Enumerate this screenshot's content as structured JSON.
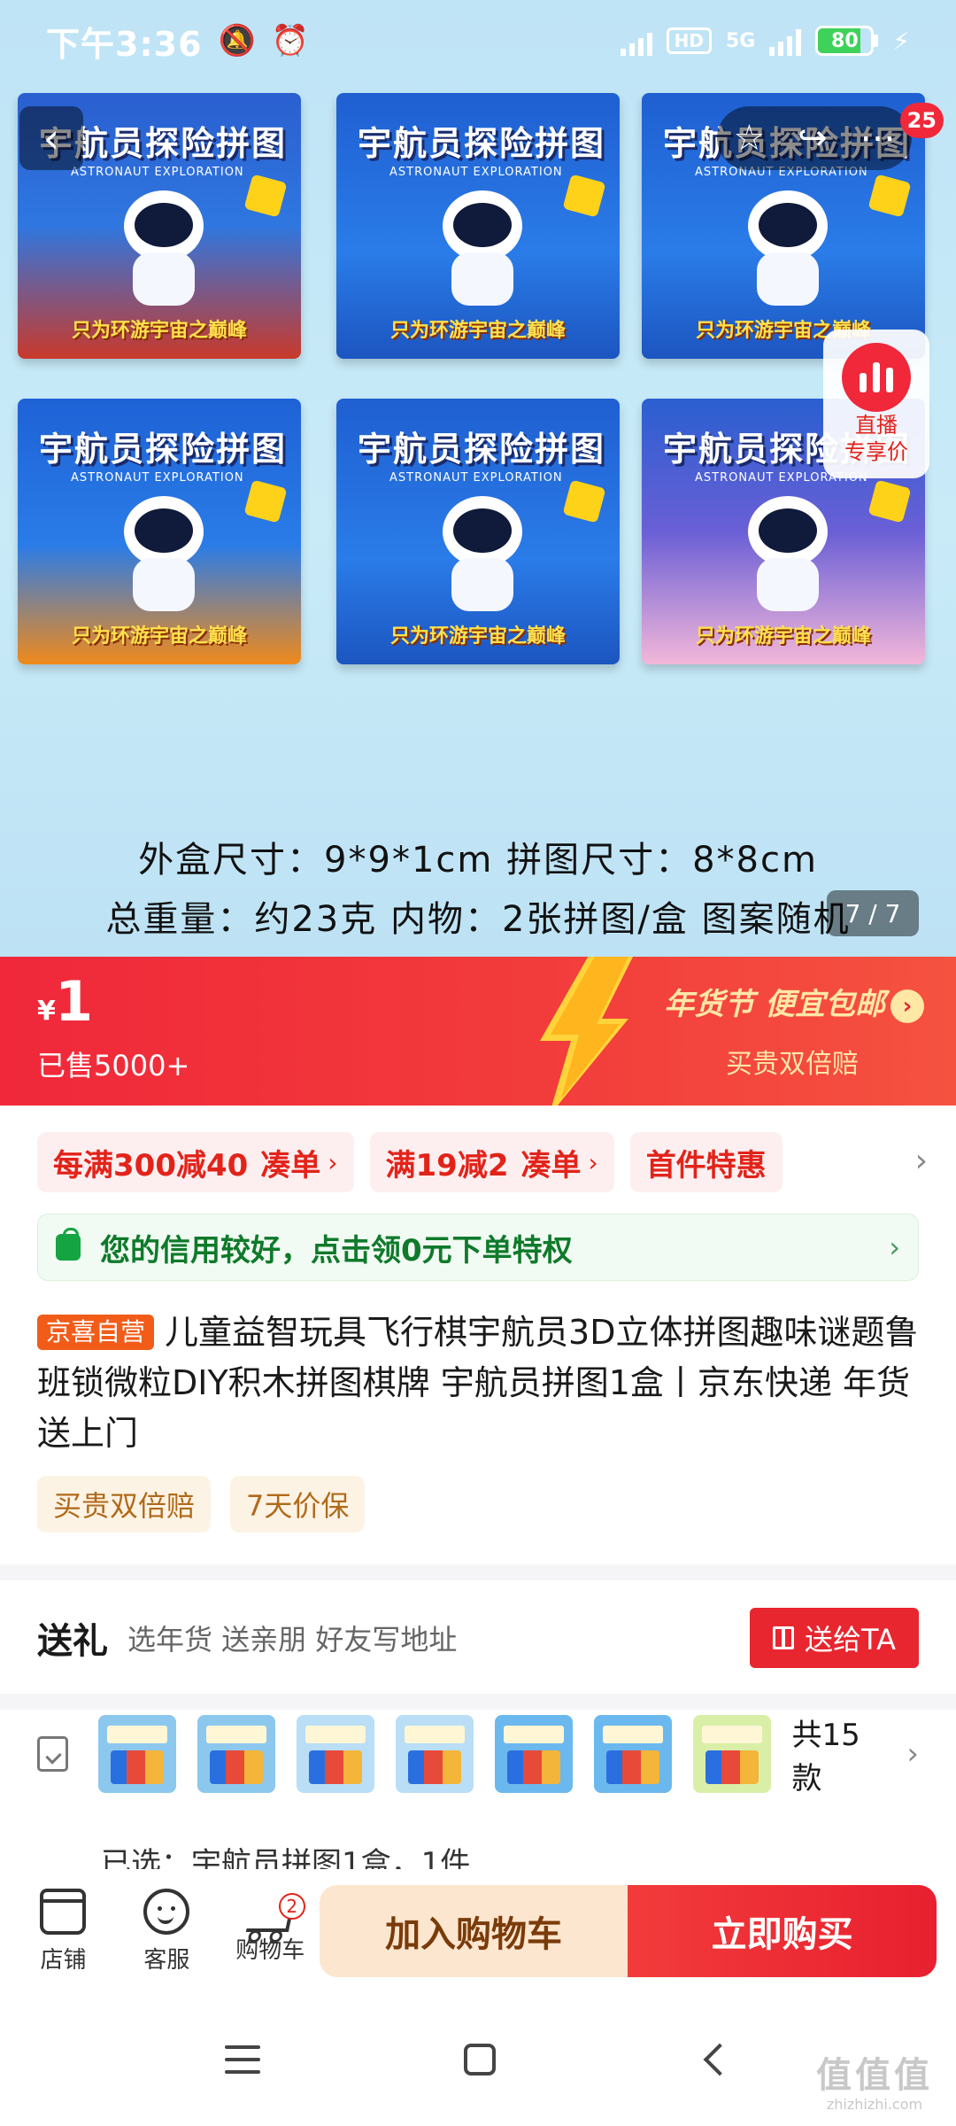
{
  "status_bar": {
    "time": "下午3:36",
    "hd": "HD",
    "network": "5G",
    "battery": "80",
    "battery_level": 0.8
  },
  "hero": {
    "cart_badge": "25",
    "box_title": "宇航员探险拼图",
    "box_subtitle": "ASTRONAUT EXPLORATION",
    "box_slogan": "只为环游宇宙之巅峰",
    "info_line1": "外盒尺寸：9*9*1cm  拼图尺寸：8*8cm",
    "info_line2": "总重量：约23克  内物：2张拼图/盒  图案随机",
    "pager": "7 / 7",
    "live_line1": "直播",
    "live_line2": "专享价"
  },
  "price": {
    "currency": "¥",
    "amount": "1",
    "sold": "已售5000+",
    "promo": "年货节 便宜包邮",
    "promo_sub": "买贵双倍赔"
  },
  "coupons": [
    {
      "label": "每满300减40",
      "action": "凑单"
    },
    {
      "label": "满19减2",
      "action": "凑单"
    },
    {
      "label": "首件特惠",
      "action": ""
    }
  ],
  "credit": {
    "text": "您的信用较好，点击领0元下单特权"
  },
  "product": {
    "tag": "京喜自营",
    "title": "儿童益智玩具飞行棋宇航员3D立体拼图趣味谜题鲁班锁微粒DIY积木拼图棋牌 宇航员拼图1盒丨京东快递 年货送上门"
  },
  "guarantees": [
    "买贵双倍赔",
    "7天价保"
  ],
  "gift": {
    "heading": "送礼",
    "desc": "选年货 送亲朋 好友写地址",
    "button": "送给TA"
  },
  "variants": {
    "count": "共15款",
    "selected": "已选：宇航员拼图1盒，1件"
  },
  "action_bar": {
    "store": "店铺",
    "service": "客服",
    "cart": "购物车",
    "cart_count": "2",
    "add_to_cart": "加入购物车",
    "buy_now": "立即购买"
  },
  "watermark": {
    "line1": "值值值",
    "line2": "zhizhizhi.com"
  },
  "colors": {
    "brand_red": "#e8262f",
    "promo_gold": "#ffe7a6",
    "credit_green": "#0f7a2a"
  }
}
